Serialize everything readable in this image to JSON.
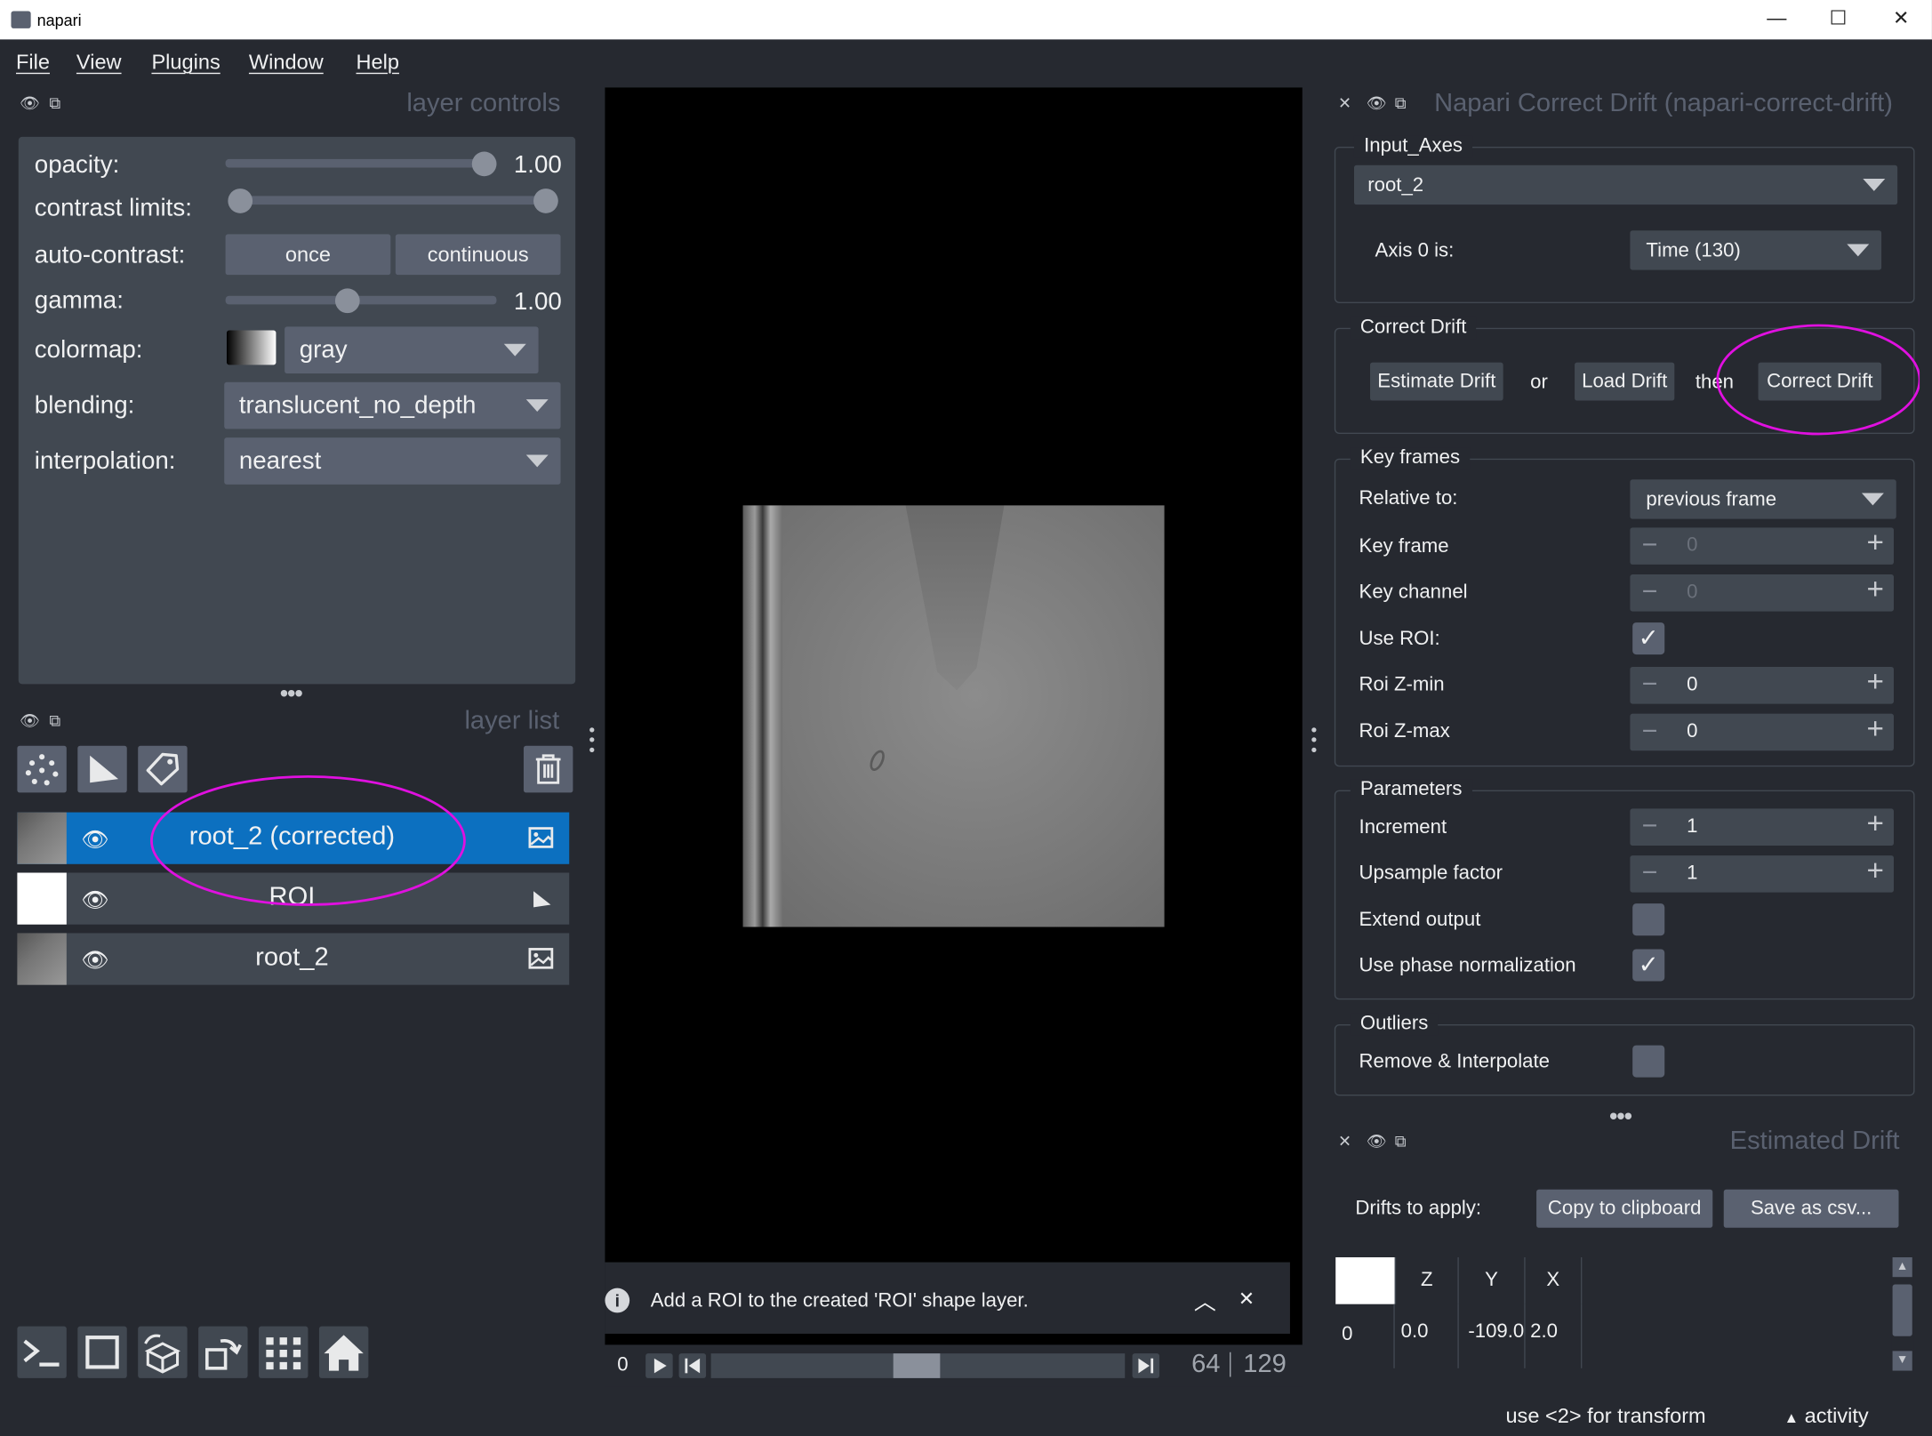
{
  "window": {
    "title": "napari",
    "minimize": "—",
    "maximize": "☐",
    "close": "✕"
  },
  "menu": [
    "File",
    "View",
    "Plugins",
    "Window",
    "Help"
  ],
  "layer_controls": {
    "title": "layer controls",
    "opacity_label": "opacity:",
    "opacity_value": "1.00",
    "opacity_fraction": 1.0,
    "contrast_label": "contrast limits:",
    "autocontrast_label": "auto-contrast:",
    "once": "once",
    "continuous": "continuous",
    "gamma_label": "gamma:",
    "gamma_value": "1.00",
    "gamma_fraction": 0.45,
    "colormap_label": "colormap:",
    "colormap_value": "gray",
    "blending_label": "blending:",
    "blending_value": "translucent_no_depth",
    "interpolation_label": "interpolation:",
    "interpolation_value": "nearest"
  },
  "layer_list": {
    "title": "layer list",
    "layers": [
      {
        "name": "root_2 (corrected)",
        "type_icon": "image-icon",
        "selected": true
      },
      {
        "name": "ROI",
        "type_icon": "shapes-icon",
        "selected": false
      },
      {
        "name": "root_2",
        "type_icon": "image-icon",
        "selected": false
      }
    ]
  },
  "canvas": {
    "notification": "Add a ROI to the created 'ROI' shape layer.",
    "slider_start": "0",
    "current_frame": "64",
    "total_frames": "129",
    "frame_fraction": 0.4961
  },
  "plugin": {
    "title": "Napari Correct Drift (napari-correct-drift)",
    "input_axes": {
      "group": "Input_Axes",
      "layer": "root_2",
      "axis_label": "Axis 0 is:",
      "axis_value": "Time (130)"
    },
    "correct_drift": {
      "group": "Correct Drift",
      "estimate": "Estimate Drift",
      "or": "or",
      "load": "Load Drift",
      "then": "then",
      "correct": "Correct Drift"
    },
    "key_frames": {
      "group": "Key frames",
      "relative_label": "Relative to:",
      "relative_value": "previous frame",
      "key_frame_label": "Key frame",
      "key_frame_value": "0",
      "key_channel_label": "Key channel",
      "key_channel_value": "0",
      "use_roi_label": "Use ROI:",
      "use_roi": true,
      "roi_zmin_label": "Roi Z-min",
      "roi_zmin_value": "0",
      "roi_zmax_label": "Roi Z-max",
      "roi_zmax_value": "0"
    },
    "parameters": {
      "group": "Parameters",
      "increment_label": "Increment",
      "increment_value": "1",
      "upsample_label": "Upsample factor",
      "upsample_value": "1",
      "extend_label": "Extend output",
      "extend": false,
      "phase_label": "Use phase normalization",
      "phase": true
    },
    "outliers": {
      "group": "Outliers",
      "remove_label": "Remove & Interpolate",
      "remove": false
    }
  },
  "estimated_drift": {
    "title": "Estimated Drift",
    "drifts_label": "Drifts to apply:",
    "copy": "Copy to clipboard",
    "save": "Save as csv...",
    "columns": [
      "Z",
      "Y",
      "X"
    ],
    "rows": [
      {
        "index": "0",
        "values": [
          "0.0",
          "-109.0",
          "2.0"
        ]
      }
    ]
  },
  "statusbar": {
    "hint": "use <2> for transform",
    "activity": "activity"
  },
  "colors": {
    "bg": "#262930",
    "panel": "#414851",
    "control": "#5a6170",
    "accent": "#0c70c0",
    "annotation": "#e010e0"
  }
}
